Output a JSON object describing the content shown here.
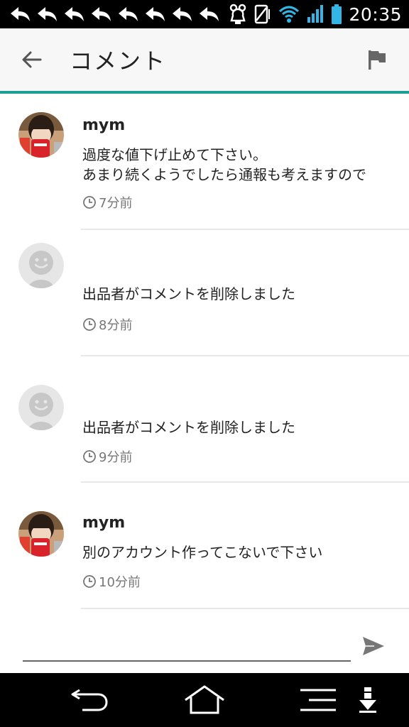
{
  "status_bar": {
    "time": "20:35",
    "notification_icons": [
      "reply-notification-icon",
      "reply-notification-icon",
      "reply-notification-icon",
      "reply-notification-icon",
      "reply-notification-icon",
      "reply-notification-icon",
      "reply-notification-icon",
      "reply-notification-icon"
    ],
    "battery_color": "#33b5e5",
    "signal_color": "#33b5e5"
  },
  "app_bar": {
    "title": "コメント",
    "back_icon": "arrow-back-icon",
    "action_icon": "flag-icon",
    "accent_color": "#1a9e96"
  },
  "comments": [
    {
      "user": "mym",
      "avatar": "user-photo",
      "text": "過度な値下げ止めて下さい。\nあまり続くようでしたら通報も考えますので",
      "time": "7分前"
    },
    {
      "user": "",
      "avatar": "default-face",
      "text": "出品者がコメントを削除しました",
      "time": "8分前"
    },
    {
      "user": "",
      "avatar": "default-face",
      "text": "出品者がコメントを削除しました",
      "time": "9分前"
    },
    {
      "user": "mym",
      "avatar": "user-photo",
      "text": "別のアカウント作ってこないで下さい",
      "time": "10分前"
    }
  ],
  "input": {
    "value": "",
    "placeholder": "",
    "send_icon": "send-icon"
  },
  "nav_bar": {
    "icons": [
      "back-nav-icon",
      "home-nav-icon",
      "menu-nav-icon",
      "download-nav-icon"
    ]
  }
}
